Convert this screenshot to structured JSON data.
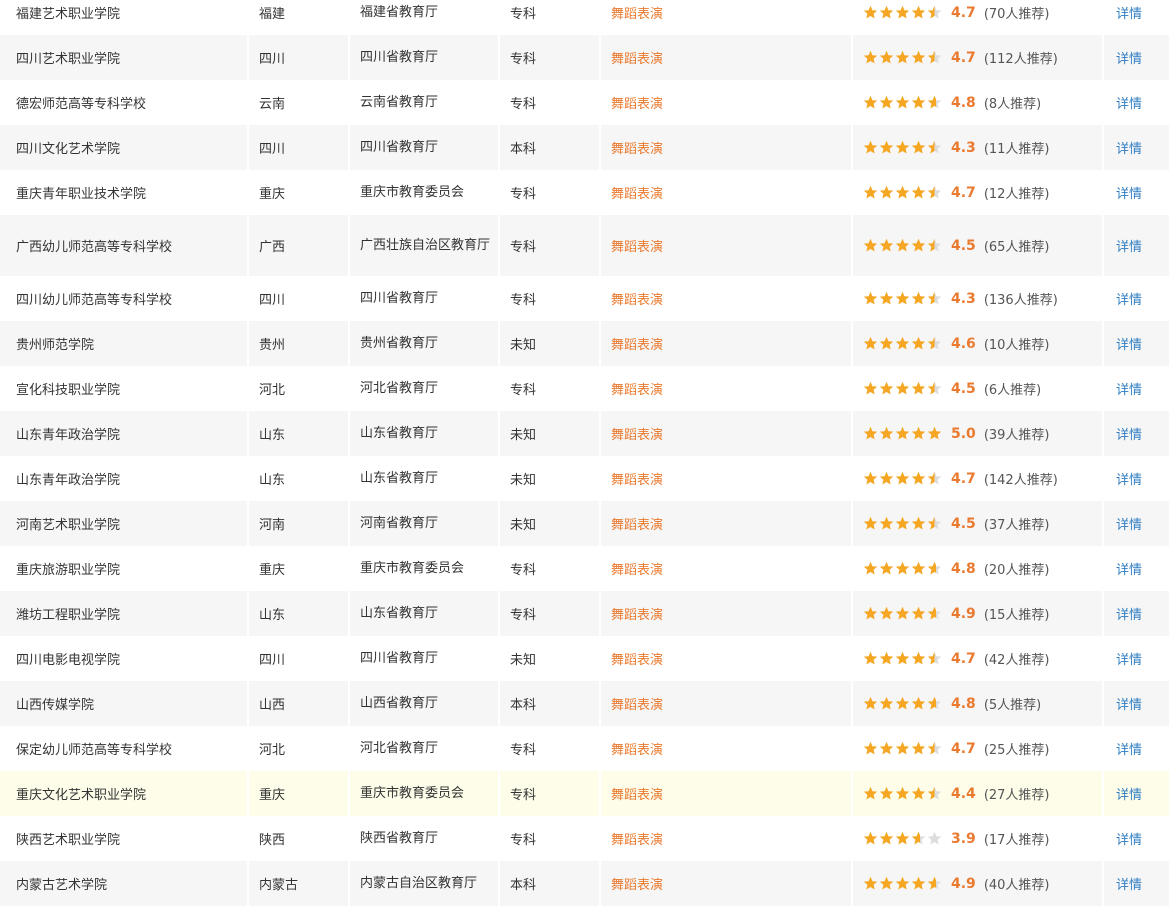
{
  "colors": {
    "accent_orange": "#ea7a2f",
    "star_gold": "#f5a623",
    "star_empty": "#dddddd",
    "link_blue": "#2e7dc1",
    "row_alt": "#f6f6f6",
    "row_highlight": "#fdfdea"
  },
  "rows": [
    {
      "name": "福建艺术职业学院",
      "province": "福建",
      "authority": "福建省教育厅",
      "level": "专科",
      "major": "舞蹈表演",
      "score": "4.7",
      "rating": 4.7,
      "count": "(70人推荐)",
      "link": "详情"
    },
    {
      "name": "四川艺术职业学院",
      "province": "四川",
      "authority": "四川省教育厅",
      "level": "专科",
      "major": "舞蹈表演",
      "score": "4.7",
      "rating": 4.7,
      "count": "(112人推荐)",
      "link": "详情"
    },
    {
      "name": "德宏师范高等专科学校",
      "province": "云南",
      "authority": "云南省教育厅",
      "level": "专科",
      "major": "舞蹈表演",
      "score": "4.8",
      "rating": 4.8,
      "count": "(8人推荐)",
      "link": "详情"
    },
    {
      "name": "四川文化艺术学院",
      "province": "四川",
      "authority": "四川省教育厅",
      "level": "本科",
      "major": "舞蹈表演",
      "score": "4.3",
      "rating": 4.3,
      "count": "(11人推荐)",
      "link": "详情"
    },
    {
      "name": "重庆青年职业技术学院",
      "province": "重庆",
      "authority": "重庆市教育委员会",
      "level": "专科",
      "major": "舞蹈表演",
      "score": "4.7",
      "rating": 4.7,
      "count": "(12人推荐)",
      "link": "详情"
    },
    {
      "name": "广西幼儿师范高等专科学校",
      "province": "广西",
      "authority": "广西壮族自治区教育厅",
      "level": "专科",
      "major": "舞蹈表演",
      "score": "4.5",
      "rating": 4.5,
      "count": "(65人推荐)",
      "link": "详情",
      "tall": true
    },
    {
      "name": "四川幼儿师范高等专科学校",
      "province": "四川",
      "authority": "四川省教育厅",
      "level": "专科",
      "major": "舞蹈表演",
      "score": "4.3",
      "rating": 4.3,
      "count": "(136人推荐)",
      "link": "详情"
    },
    {
      "name": "贵州师范学院",
      "province": "贵州",
      "authority": "贵州省教育厅",
      "level": "未知",
      "major": "舞蹈表演",
      "score": "4.6",
      "rating": 4.6,
      "count": "(10人推荐)",
      "link": "详情"
    },
    {
      "name": "宣化科技职业学院",
      "province": "河北",
      "authority": "河北省教育厅",
      "level": "专科",
      "major": "舞蹈表演",
      "score": "4.5",
      "rating": 4.5,
      "count": "(6人推荐)",
      "link": "详情"
    },
    {
      "name": "山东青年政治学院",
      "province": "山东",
      "authority": "山东省教育厅",
      "level": "未知",
      "major": "舞蹈表演",
      "score": "5.0",
      "rating": 5.0,
      "count": "(39人推荐)",
      "link": "详情"
    },
    {
      "name": "山东青年政治学院",
      "province": "山东",
      "authority": "山东省教育厅",
      "level": "未知",
      "major": "舞蹈表演",
      "score": "4.7",
      "rating": 4.7,
      "count": "(142人推荐)",
      "link": "详情"
    },
    {
      "name": "河南艺术职业学院",
      "province": "河南",
      "authority": "河南省教育厅",
      "level": "未知",
      "major": "舞蹈表演",
      "score": "4.5",
      "rating": 4.5,
      "count": "(37人推荐)",
      "link": "详情"
    },
    {
      "name": "重庆旅游职业学院",
      "province": "重庆",
      "authority": "重庆市教育委员会",
      "level": "专科",
      "major": "舞蹈表演",
      "score": "4.8",
      "rating": 4.8,
      "count": "(20人推荐)",
      "link": "详情"
    },
    {
      "name": "潍坊工程职业学院",
      "province": "山东",
      "authority": "山东省教育厅",
      "level": "专科",
      "major": "舞蹈表演",
      "score": "4.9",
      "rating": 4.9,
      "count": "(15人推荐)",
      "link": "详情"
    },
    {
      "name": "四川电影电视学院",
      "province": "四川",
      "authority": "四川省教育厅",
      "level": "未知",
      "major": "舞蹈表演",
      "score": "4.7",
      "rating": 4.7,
      "count": "(42人推荐)",
      "link": "详情"
    },
    {
      "name": "山西传媒学院",
      "province": "山西",
      "authority": "山西省教育厅",
      "level": "本科",
      "major": "舞蹈表演",
      "score": "4.8",
      "rating": 4.8,
      "count": "(5人推荐)",
      "link": "详情"
    },
    {
      "name": "保定幼儿师范高等专科学校",
      "province": "河北",
      "authority": "河北省教育厅",
      "level": "专科",
      "major": "舞蹈表演",
      "score": "4.7",
      "rating": 4.7,
      "count": "(25人推荐)",
      "link": "详情"
    },
    {
      "name": "重庆文化艺术职业学院",
      "province": "重庆",
      "authority": "重庆市教育委员会",
      "level": "专科",
      "major": "舞蹈表演",
      "score": "4.4",
      "rating": 4.4,
      "count": "(27人推荐)",
      "link": "详情",
      "highlight": true
    },
    {
      "name": "陕西艺术职业学院",
      "province": "陕西",
      "authority": "陕西省教育厅",
      "level": "专科",
      "major": "舞蹈表演",
      "score": "3.9",
      "rating": 3.9,
      "count": "(17人推荐)",
      "link": "详情"
    },
    {
      "name": "内蒙古艺术学院",
      "province": "内蒙古",
      "authority": "内蒙古自治区教育厅",
      "level": "本科",
      "major": "舞蹈表演",
      "score": "4.9",
      "rating": 4.9,
      "count": "(40人推荐)",
      "link": "详情"
    }
  ]
}
